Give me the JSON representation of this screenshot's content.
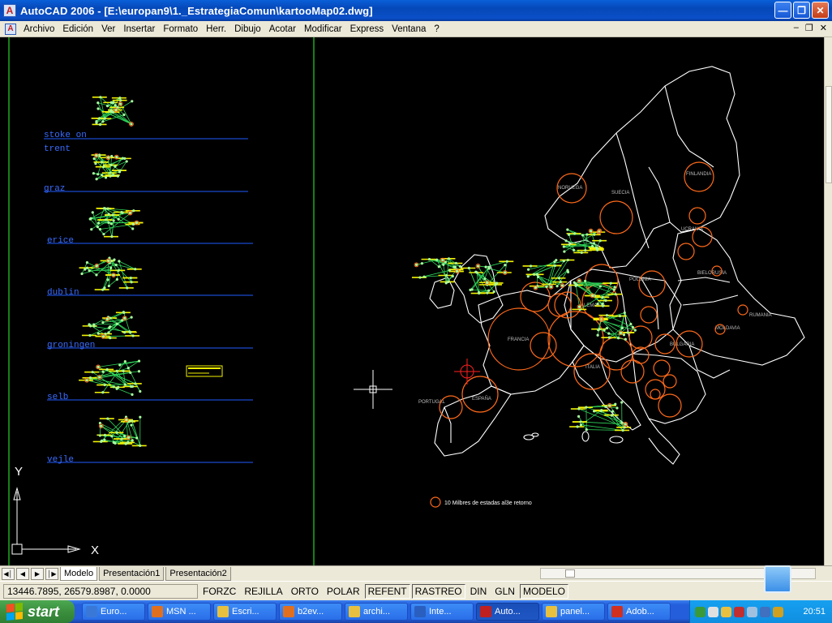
{
  "window": {
    "title": "AutoCAD 2006 - [E:\\europan9\\1._EstrategiaComun\\kartooMap02.dwg]",
    "app_icon_letter": "A"
  },
  "menubar": {
    "items": [
      "Archivo",
      "Edición",
      "Ver",
      "Insertar",
      "Formato",
      "Herr.",
      "Dibujo",
      "Acotar",
      "Modificar",
      "Express",
      "Ventana",
      "?"
    ]
  },
  "drawing": {
    "city_labels": [
      "stoke on",
      "trent",
      "graz",
      "erice",
      "dublin",
      "groningen",
      "selb",
      "vejle"
    ],
    "legend_text": "10 Milbres de estadas al3e retorno",
    "ucs": {
      "x_label": "X",
      "y_label": "Y"
    },
    "country_labels": [
      "NORUEGA",
      "SUECIA",
      "FINLANDIA",
      "POLONIA",
      "FRANCIA",
      "ESPAÑA",
      "PORTUGAL",
      "ITALIA",
      "ALEMANIA",
      "RUMANIA",
      "BULGARIA",
      "UCRANIA",
      "BIELORUSIA",
      "MOLDAVIA"
    ],
    "colors": {
      "outline": "#ffffff",
      "circles": "#ff6a1a",
      "labels": "#3a6cff",
      "lines": "#1f5cff",
      "network": "#f2f200",
      "nodes": "#a8ffa0",
      "divider": "#2cff2c"
    }
  },
  "tabs": {
    "items": [
      "Modelo",
      "Presentación1",
      "Presentación2"
    ],
    "active": "Modelo"
  },
  "status": {
    "coords": "13446.7895, 26579.8987, 0.0000",
    "buttons": [
      {
        "label": "FORZC",
        "on": false
      },
      {
        "label": "REJILLA",
        "on": false
      },
      {
        "label": "ORTO",
        "on": false
      },
      {
        "label": "POLAR",
        "on": false
      },
      {
        "label": "REFENT",
        "on": true
      },
      {
        "label": "RASTREO",
        "on": true
      },
      {
        "label": "DIN",
        "on": false
      },
      {
        "label": "GLN",
        "on": false
      },
      {
        "label": "MODELO",
        "on": true
      }
    ]
  },
  "taskbar": {
    "start_label": "start",
    "tasks": [
      {
        "label": "Euro...",
        "color": "#3a78d8"
      },
      {
        "label": "MSN ...",
        "color": "#e07020"
      },
      {
        "label": "Escri...",
        "color": "#e8c040"
      },
      {
        "label": "b2ev...",
        "color": "#e07020"
      },
      {
        "label": "archi...",
        "color": "#e8c040"
      },
      {
        "label": "Inte...",
        "color": "#2a5fc0"
      },
      {
        "label": "Auto...",
        "color": "#c02020"
      },
      {
        "label": "panel...",
        "color": "#e8c040"
      },
      {
        "label": "Adob...",
        "color": "#d03020"
      }
    ],
    "active_task": "Auto...",
    "clock": "20:51"
  }
}
